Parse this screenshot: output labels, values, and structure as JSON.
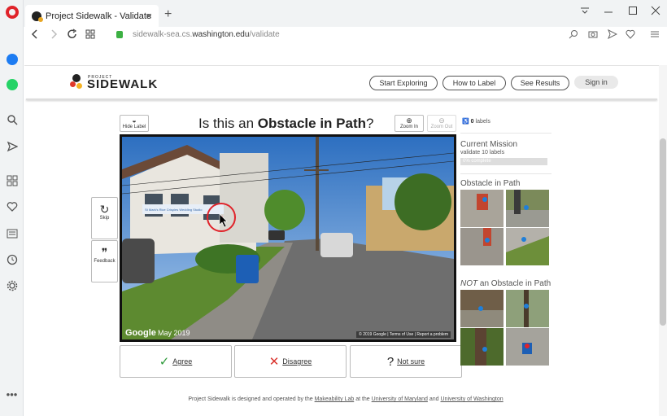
{
  "browser": {
    "tab_title": "Project Sidewalk - Validate",
    "url_prefix": "sidewalk-sea.cs.",
    "url_domain": "washington.edu",
    "url_path": "/validate",
    "tab_close": "×",
    "new_tab": "+"
  },
  "header": {
    "logo_small": "PROJECT",
    "logo_text": "SIDEWALK",
    "nav": [
      {
        "label": "Start Exploring"
      },
      {
        "label": "How to Label"
      },
      {
        "label": "See Results"
      }
    ],
    "sign_in": "Sign in"
  },
  "validate": {
    "hide_label": "Hide Label",
    "question_prefix": "Is this an",
    "question_label": "Obstacle in Path",
    "question_suffix": "?",
    "zoom_in": "Zoom In",
    "zoom_out": "Zoom Out",
    "skip": "Skip",
    "feedback": "Feedback",
    "agree": "Agree",
    "disagree": "Disagree",
    "not_sure": "Not sure",
    "google": "Google",
    "pano_date": "May 2019",
    "pano_legal": "© 2019 Google | Terms of Use | Report a problem",
    "pano_sign": "St Mark's Rice Crispies Wedding Studio"
  },
  "panel": {
    "label_count": "0",
    "label_count_suffix": "labels",
    "mission_title": "Current Mission",
    "mission_sub": "validate 10 labels",
    "progress_text": "0% complete",
    "progress_fraction": 0,
    "obstacle_title": "Obstacle in Path",
    "not_prefix": "NOT",
    "not_suffix": "an Obstacle in Path"
  },
  "footer": {
    "prefix": "Project Sidewalk is designed and operated by the",
    "lab": "Makeability Lab",
    "at_the": "at the",
    "umd": "University of Maryland",
    "and": "and",
    "uw": "University of Washington"
  },
  "colors": {
    "agree": "#2e9a3a",
    "disagree": "#d9322c",
    "accent_red": "#e0232a"
  }
}
